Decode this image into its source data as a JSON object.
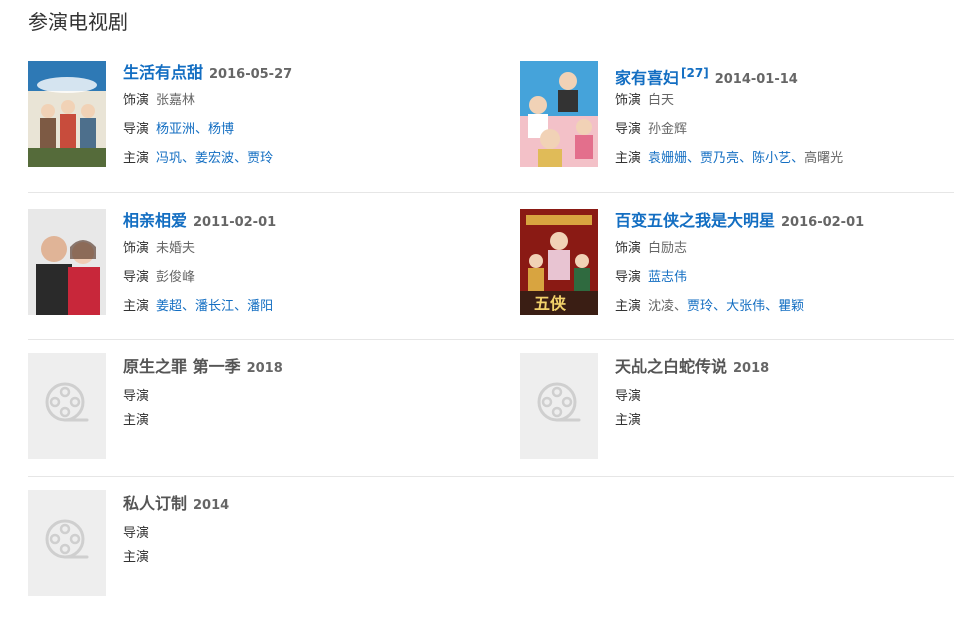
{
  "section": {
    "title": "参演电视剧"
  },
  "labels": {
    "role": "饰演",
    "director": "导演",
    "cast": "主演"
  },
  "works": [
    {
      "title": "生活有点甜",
      "date": "2016-05-27",
      "ref": "",
      "role": "张嘉林",
      "directors": [
        {
          "name": "杨亚洲",
          "linked": true
        },
        {
          "name": "杨博",
          "linked": true
        }
      ],
      "cast": [
        {
          "name": "冯巩",
          "linked": true
        },
        {
          "name": "姜宏波",
          "linked": true
        },
        {
          "name": "贾玲",
          "linked": true
        }
      ],
      "poster": "image",
      "poster_colors": [
        "#2e79b5",
        "#e9e4d6",
        "#7d5a44"
      ]
    },
    {
      "title": "家有喜妇",
      "date": "2014-01-14",
      "ref": "[27]",
      "role": "白天",
      "directors": [
        {
          "name": "孙金辉",
          "linked": false
        }
      ],
      "cast": [
        {
          "name": "袁姗姗",
          "linked": true
        },
        {
          "name": "贾乃亮",
          "linked": true
        },
        {
          "name": "陈小艺",
          "linked": true
        },
        {
          "name": "高曙光",
          "linked": false
        }
      ],
      "poster": "image",
      "poster_colors": [
        "#45a3da",
        "#f3c1c8",
        "#e0bb58"
      ]
    },
    {
      "title": "相亲相爱",
      "date": "2011-02-01",
      "ref": "",
      "role": "未婚夫",
      "directors": [
        {
          "name": "彭俊峰",
          "linked": false
        }
      ],
      "cast": [
        {
          "name": "姜超",
          "linked": true
        },
        {
          "name": "潘长江",
          "linked": true
        },
        {
          "name": "潘阳",
          "linked": true
        }
      ],
      "poster": "image",
      "poster_colors": [
        "#e8e8e8",
        "#2a2a2a",
        "#c8273a"
      ]
    },
    {
      "title": "百变五侠之我是大明星",
      "date": "2016-02-01",
      "ref": "",
      "role": "白励志",
      "directors": [
        {
          "name": "蓝志伟",
          "linked": true
        }
      ],
      "cast": [
        {
          "name": "沈凌",
          "linked": false
        },
        {
          "name": "贾玲",
          "linked": true
        },
        {
          "name": "大张伟",
          "linked": true
        },
        {
          "name": "瞿颖",
          "linked": true
        }
      ],
      "poster": "image",
      "poster_colors": [
        "#8a1a14",
        "#d8a440",
        "#3a1e14"
      ]
    },
    {
      "title": "原生之罪 第一季",
      "date": "2018",
      "ref": "",
      "role": "",
      "directors": [],
      "cast": [],
      "poster": "placeholder"
    },
    {
      "title": "天乩之白蛇传说",
      "date": "2018",
      "ref": "",
      "role": "",
      "directors": [],
      "cast": [],
      "poster": "placeholder"
    },
    {
      "title": "私人订制",
      "date": "2014",
      "ref": "",
      "role": "",
      "directors": [],
      "cast": [],
      "poster": "placeholder"
    }
  ]
}
